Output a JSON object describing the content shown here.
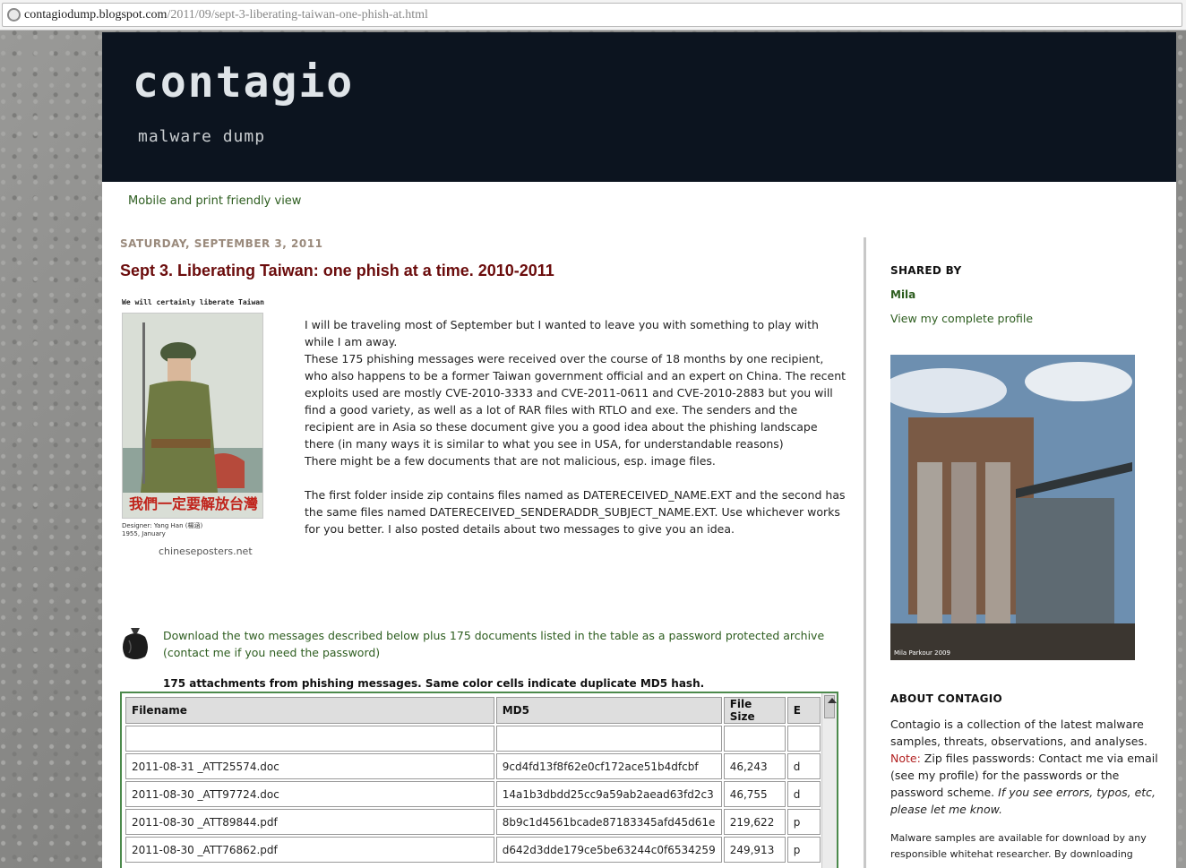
{
  "browser": {
    "url_host": "contagiodump.blogspot.com",
    "url_path": "/2011/09/sept-3-liberating-taiwan-one-phish-at.html"
  },
  "header": {
    "title": "contagio",
    "description": "malware dump"
  },
  "nav": {
    "mobile_link": "Mobile and print friendly view"
  },
  "post": {
    "date": "SATURDAY, SEPTEMBER 3, 2011",
    "title": "Sept 3. Liberating Taiwan: one phish at a time. 2010-2011",
    "poster_top_caption": "We will certainly liberate Taiwan",
    "poster_chinese": "我們一定要解放台灣",
    "poster_credit_line1": "Designer: Yang Han (楊涵)",
    "poster_credit_line2": "1955, January",
    "poster_source": "chineseposters.net",
    "paragraphs": [
      "I will be traveling most of September but I wanted to leave you with something to play with while I am away.",
      "These 175 phishing messages were received over the course of 18 months by one recipient, who also happens to be a former Taiwan government official and an expert on China. The recent exploits used are mostly CVE-2010-3333 and CVE-2011-0611 and CVE-2010-2883 but you will find a good variety, as well as a lot of RAR files with RTLO and exe. The senders and the recipient are in Asia so these document give you a good idea about the phishing landscape there (in many ways it is similar to what you see in USA, for understandable reasons)",
      "There might be a few documents that are not malicious, esp. image files.",
      "The first folder inside zip contains files named as DATERECEIVED_NAME.EXT and the second has the same files named DATERECEIVED_SENDERADDR_SUBJECT_NAME.EXT. Use whichever works for you better. I also posted details about two messages to give you an idea."
    ],
    "download_link": "Download the two messages described below plus 175 documents listed in the table as a password protected archive (contact me if you need the password)",
    "table_heading": "175 attachments from phishing messages. Same color cells indicate duplicate MD5 hash.",
    "table": {
      "columns": [
        "Filename",
        "MD5",
        "File Size",
        "E"
      ],
      "rows": [
        [
          "",
          "",
          "",
          ""
        ],
        [
          "2011-08-31 _ATT25574.doc",
          "9cd4fd13f8f62e0cf172ace51b4dfcbf",
          "46,243",
          "d"
        ],
        [
          "2011-08-30 _ATT97724.doc",
          "14a1b3dbdd25cc9a59ab2aead63fd2c3",
          "46,755",
          "d"
        ],
        [
          "2011-08-30 _ATT89844.pdf",
          "8b9c1d4561bcade87183345afd45d61e",
          "219,622",
          "p"
        ],
        [
          "2011-08-30 _ATT76862.pdf",
          "d642d3dde179ce5be63244c0f6534259",
          "249,913",
          "p"
        ]
      ]
    }
  },
  "sidebar": {
    "shared_by_heading": "SHARED BY",
    "author": "Mila",
    "profile_link": "View my complete profile",
    "photo_caption": "Mila Parkour 2009",
    "about_heading": "ABOUT CONTAGIO",
    "about_text_1": "Contagio is a collection of the latest malware samples, threats, observations, and analyses.",
    "about_note_label": "Note:",
    "about_text_2": " Zip files passwords: Contact me via email (see my profile) for the passwords or the password scheme. ",
    "about_text_3": "If you see errors, typos, etc, please let me know.",
    "about_small": "Malware samples are available for download by any responsible whitehat researcher. By downloading"
  }
}
